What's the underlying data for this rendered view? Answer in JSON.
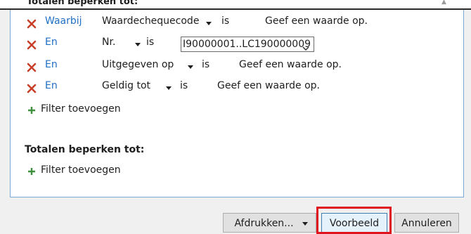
{
  "header": {
    "cut_off_title": "Totalen beperken tot:"
  },
  "filters": [
    {
      "operator": "Waarbij",
      "field": "Waardechequecode",
      "comparator": "is",
      "value": "Geef een waarde op.",
      "editing": false
    },
    {
      "operator": "En",
      "field": "Nr.",
      "comparator": "is",
      "value": "I90000001..LC190000009",
      "editing": true
    },
    {
      "operator": "En",
      "field": "Uitgegeven op",
      "comparator": "is",
      "value": "Geef een waarde op.",
      "editing": false
    },
    {
      "operator": "En",
      "field": "Geldig tot",
      "comparator": "is",
      "value": "Geef een waarde op.",
      "editing": false
    }
  ],
  "add_filter_label": "Filter toevoegen",
  "totals": {
    "title": "Totalen beperken tot:",
    "add_filter_label": "Filter toevoegen"
  },
  "buttons": {
    "print": "Afdrukken...",
    "preview": "Voorbeeld",
    "cancel": "Annuleren"
  },
  "colors": {
    "operator_link": "#1f6fc4",
    "remove_icon": "#c8402a",
    "add_icon": "#3e8f3e",
    "highlight": "#e0141e"
  },
  "icons": {
    "remove": "x-icon",
    "add": "plus-icon",
    "dropdown": "caret-down-icon"
  }
}
